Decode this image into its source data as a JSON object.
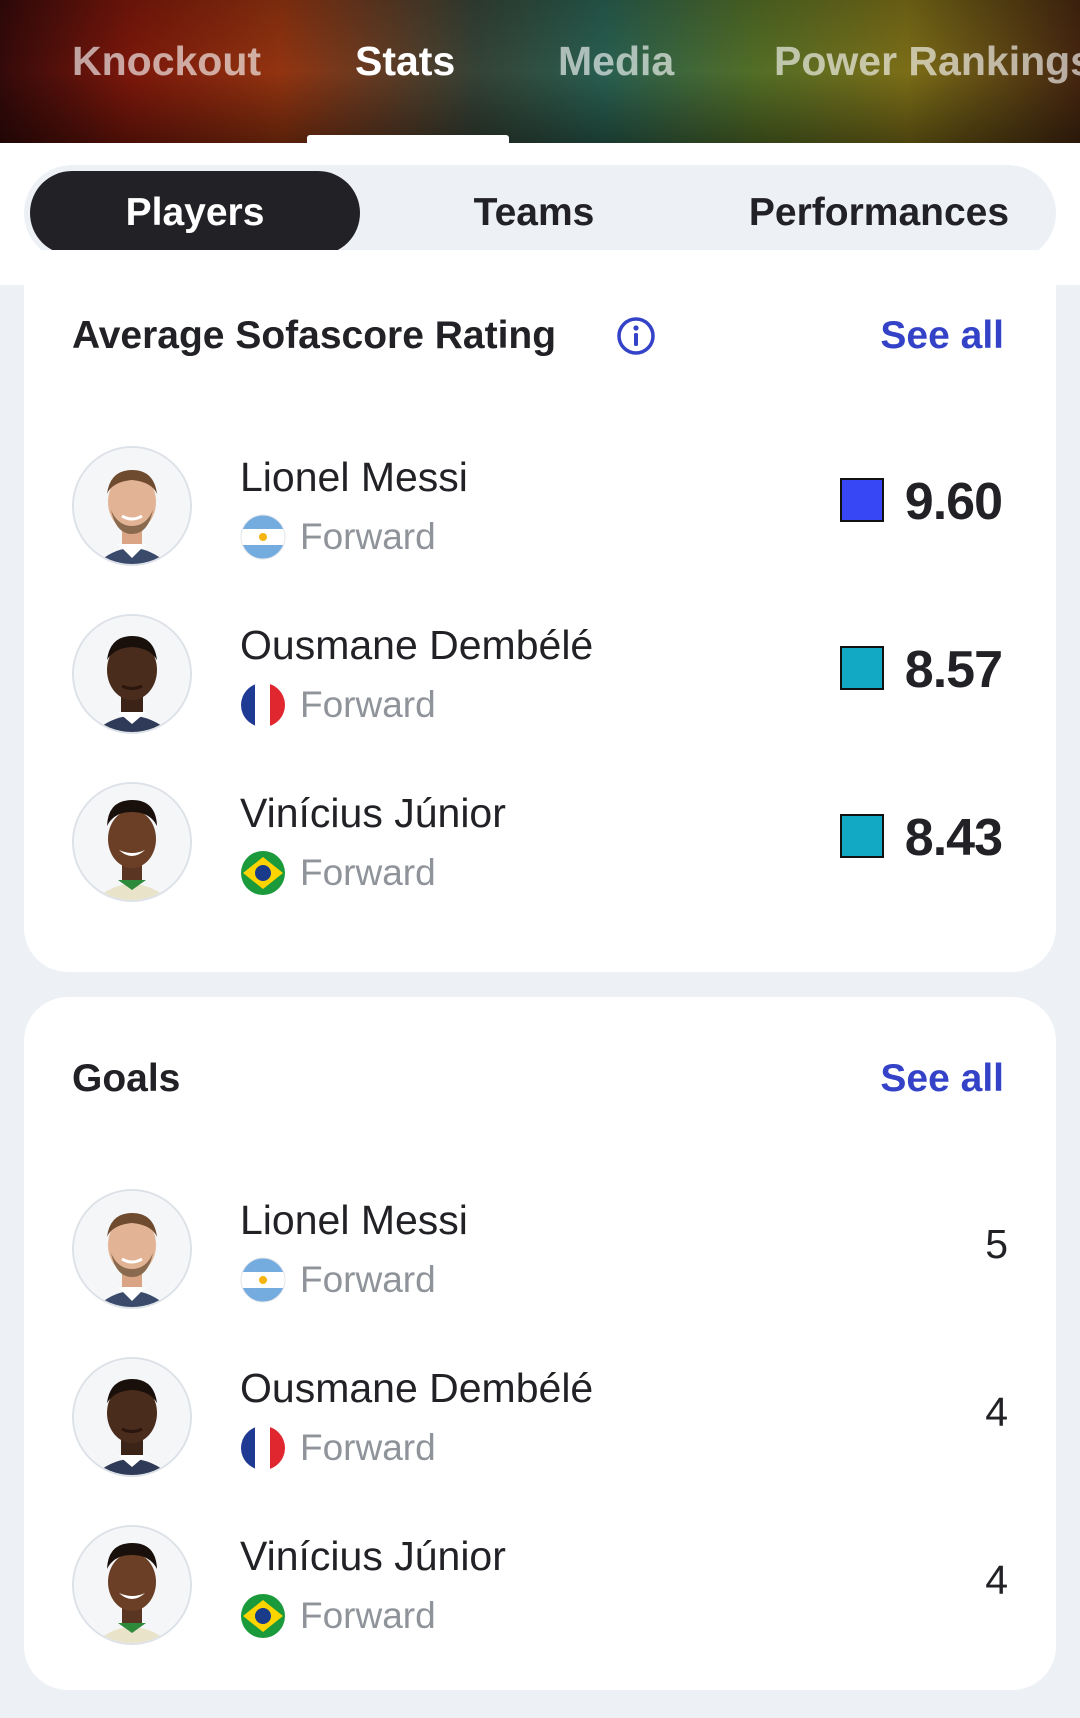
{
  "top_tabs": [
    {
      "label": "Knockout",
      "active": false
    },
    {
      "label": "Stats",
      "active": true
    },
    {
      "label": "Media",
      "active": false
    },
    {
      "label": "Power Rankings",
      "active": false
    }
  ],
  "segments": [
    {
      "label": "Players",
      "active": true
    },
    {
      "label": "Teams",
      "active": false
    },
    {
      "label": "Performances",
      "active": false
    }
  ],
  "rating_card": {
    "title": "Average Sofascore Rating",
    "see_all": "See all",
    "rows": [
      {
        "name": "Lionel Messi",
        "position": "Forward",
        "flag": "argentina-flag-icon",
        "value": "9.60",
        "color": "#3747f5"
      },
      {
        "name": "Ousmane Dembélé",
        "position": "Forward",
        "flag": "france-flag-icon",
        "value": "8.57",
        "color": "#12a9c4"
      },
      {
        "name": "Vinícius Júnior",
        "position": "Forward",
        "flag": "brazil-flag-icon",
        "value": "8.43",
        "color": "#12a9c4"
      }
    ]
  },
  "goals_card": {
    "title": "Goals",
    "see_all": "See all",
    "rows": [
      {
        "name": "Lionel Messi",
        "position": "Forward",
        "flag": "argentina-flag-icon",
        "value": "5"
      },
      {
        "name": "Ousmane Dembélé",
        "position": "Forward",
        "flag": "france-flag-icon",
        "value": "4"
      },
      {
        "name": "Vinícius Júnior",
        "position": "Forward",
        "flag": "brazil-flag-icon",
        "value": "4"
      }
    ]
  },
  "colors": {
    "accent": "#3442c8",
    "dark": "#222226",
    "muted": "#8f939a",
    "background": "#edf1f6"
  }
}
